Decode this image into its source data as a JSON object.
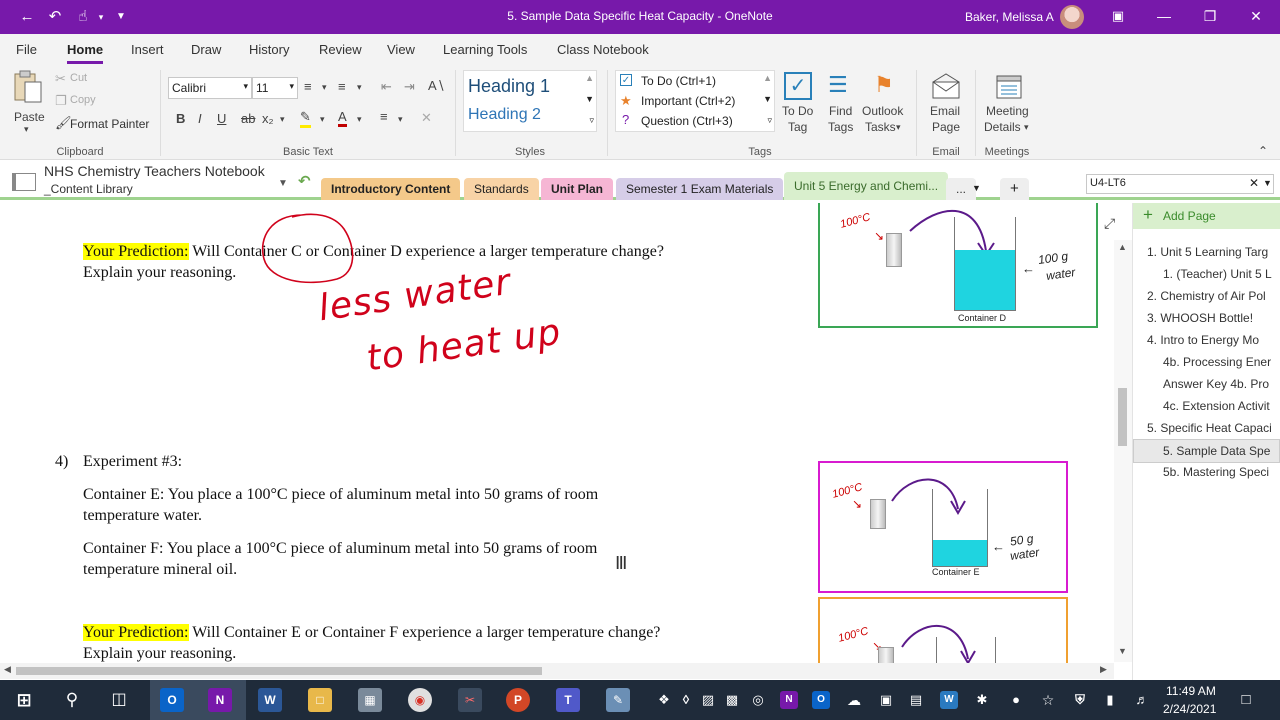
{
  "window": {
    "title": "5. Sample Data Specific Heat Capacity  -  OneNote",
    "user": "Baker, Melissa A",
    "back_icon": "back-arrow-icon",
    "undo_icon": "undo-icon",
    "touch_icon": "touch-mode-icon",
    "customize_icon": "customize-qat-icon",
    "accent": "#7719aa"
  },
  "menu": {
    "tabs": [
      "File",
      "Home",
      "Insert",
      "Draw",
      "History",
      "Review",
      "View",
      "Learning Tools",
      "Class Notebook"
    ],
    "active": "Home"
  },
  "ribbon": {
    "clipboard": {
      "paste": "Paste",
      "cut": "Cut",
      "copy": "Copy",
      "format_painter": "Format Painter",
      "label": "Clipboard"
    },
    "basic_text": {
      "font": "Calibri",
      "size": "11",
      "label": "Basic Text"
    },
    "styles": {
      "heading1": "Heading 1",
      "heading2": "Heading 2",
      "label": "Styles"
    },
    "tags": {
      "todo": "To Do (Ctrl+1)",
      "important": "Important (Ctrl+2)",
      "question": "Question (Ctrl+3)",
      "todo_tag_1": "To Do",
      "todo_tag_2": "Tag",
      "find_tags_1": "Find",
      "find_tags_2": "Tags",
      "outlook_tasks_1": "Outlook",
      "outlook_tasks_2": "Tasks",
      "label": "Tags"
    },
    "email": {
      "line1": "Email",
      "line2": "Page",
      "label": "Email"
    },
    "meetings": {
      "line1": "Meeting",
      "line2": "Details",
      "label": "Meetings"
    }
  },
  "notebook": {
    "name": "NHS Chemistry Teachers Notebook",
    "section_group": "_Content Library",
    "sections": [
      {
        "label": "Introductory Content",
        "color": "#f4c98a"
      },
      {
        "label": "Standards",
        "color": "#f8d3a6"
      },
      {
        "label": "Unit Plan",
        "color": "#f6b6d4"
      },
      {
        "label": "Semester 1 Exam Materials",
        "color": "#d6cde8"
      },
      {
        "label": "Unit 5 Energy and Chemi...",
        "color": "#d9efcd"
      }
    ],
    "more": "...",
    "search": "U4-LT6"
  },
  "content": {
    "prediction_label": "Your Prediction:",
    "prediction1": " Will Container C or Container D experience a larger temperature change?",
    "explain": "Explain your reasoning.",
    "handwriting_1": "less water",
    "handwriting_2": "to heat up",
    "q_number": "4)",
    "q_title": "Experiment #3:",
    "e_line1": "Container E: You place a 100°C piece of aluminum metal into 50 grams of room",
    "e_line2": "temperature water.",
    "f_line1": "Container F: You place a 100°C piece of aluminum metal into 50 grams of room",
    "f_line2": "temperature mineral oil.",
    "prediction2": " Will Container E or Container F experience a larger temperature change?",
    "img_d": {
      "temp": "100°C",
      "amount_1": "100 g",
      "amount_2": "water",
      "caption": "Container D"
    },
    "img_e": {
      "temp": "100°C",
      "amount_1": "50 g",
      "amount_2": "water",
      "caption": "Container E"
    },
    "img_f": {
      "temp": "100°C"
    }
  },
  "pages": {
    "add": "Add Page",
    "items": [
      {
        "label": "1. Unit 5 Learning Targ",
        "indent": 0
      },
      {
        "label": "1. (Teacher) Unit 5 L",
        "indent": 1
      },
      {
        "label": "2. Chemistry of Air Pol",
        "indent": 0
      },
      {
        "label": "3. WHOOSH Bottle!",
        "indent": 0
      },
      {
        "label": "4. Intro to Energy Mo",
        "indent": 0
      },
      {
        "label": "4b. Processing Ener",
        "indent": 1
      },
      {
        "label": "Answer Key 4b. Pro",
        "indent": 1
      },
      {
        "label": "4c. Extension Activit",
        "indent": 1
      },
      {
        "label": "5. Specific Heat Capaci",
        "indent": 0
      },
      {
        "label": "5. Sample Data Spe",
        "indent": 1,
        "selected": true
      },
      {
        "label": "5b. Mastering Speci",
        "indent": 1
      }
    ]
  },
  "taskbar": {
    "time": "11:49 AM",
    "date": "2/24/2021"
  }
}
